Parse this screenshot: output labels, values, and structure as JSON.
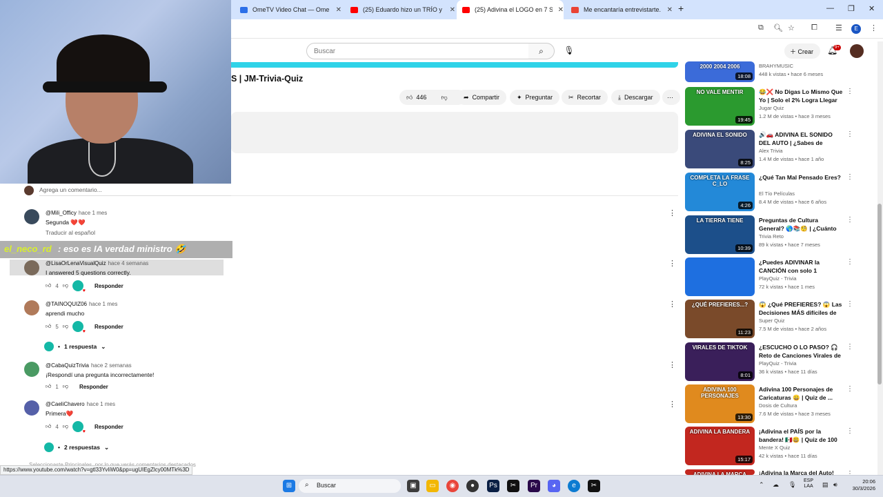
{
  "browser": {
    "tabs": [
      {
        "title": "OmeTV Video Chat — Ome",
        "fav": "#2c6fe8"
      },
      {
        "title": "(25) Eduardo hizo un TRÍO y nc",
        "fav": "#ff0000"
      },
      {
        "title": "(25) Adivina el LOGO en 7 SEG",
        "fav": "#ff0000",
        "active": true
      },
      {
        "title": "Me encantaría entrevistarte. -",
        "fav": "#ea4335"
      }
    ],
    "profile_initial": "E",
    "status_url": "https://www.youtube.com/watch?v=gtl33YvIiW0&pp=ugUIEgZlcy00MTk%3D"
  },
  "youtube": {
    "search_placeholder": "Buscar",
    "create_label": "Crear",
    "notif_count": "9+",
    "video_title": "S | JM-Trivia-Quiz",
    "actions": {
      "likes": "446",
      "share": "Compartir",
      "ask": "Preguntar",
      "clip": "Recortar",
      "download": "Descargar"
    },
    "add_comment": "Agrega un comentario...",
    "reply_label": "Responder",
    "translate_label": "Traducir al español",
    "sort_hint": "Seleccionaste Principales, por lo que verás comentarios destacados"
  },
  "chat_overlay": {
    "user": "el_neco_rd",
    "message": ": eso es IA verdad ministro 🤣"
  },
  "comments": [
    {
      "author": "@Mili_Officy",
      "time": "hace 1 mes",
      "text": "Segunda ❤️❤️",
      "likes": "",
      "translate": true,
      "avatar": "#394a5c"
    },
    {
      "author": "@LisaOrLenaVisualQuiz",
      "time": "hace 4 semanas",
      "text": "I answered 5 questions correctly.",
      "likes": "4",
      "avatar": "#7a6a5b"
    },
    {
      "author": "@TAINOQUIZ06",
      "time": "hace 1 mes",
      "text": "aprendi mucho",
      "likes": "5",
      "avatar": "#b07a5a"
    },
    {
      "author": "@CabaQuizTrivia",
      "time": "hace 2 semanas",
      "text": "¡Respondí una pregunta incorrectamente!",
      "likes": "1",
      "avatar": "#4a9a63"
    },
    {
      "author": "@CaeliChavero",
      "time": "hace 1 mes",
      "text": "Primera❤️",
      "likes": "4",
      "avatar": "#5560a8"
    }
  ],
  "replies": [
    "1 respuesta",
    "2 respuestas"
  ],
  "sidebar": [
    {
      "title": "",
      "channel": "BRAHYMUSIC",
      "meta": "448 k vistas • hace 6 meses",
      "duration": "18:08",
      "caption": "2000  2004  2006",
      "color": "#3b6bd9"
    },
    {
      "title": "😂❌ No Digas Lo Mismo Que Yo | Solo el 2% Logra Llegar",
      "channel": "Jugar Quiz",
      "meta": "1.2 M de vistas • hace 3 meses",
      "duration": "19:45",
      "caption": "NO VALE MENTIR",
      "color": "#2b9a2f"
    },
    {
      "title": "🔊🚗 ADIVINA EL SONIDO DEL AUTO | ¿Sabes de Autos? 🚗 ...",
      "channel": "Alex Trivia",
      "meta": "1.4 M de vistas • hace 1 año",
      "duration": "8:25",
      "caption": "ADIVINA EL SONIDO",
      "color": "#3a4a7a"
    },
    {
      "title": "¿Qué Tan Mal Pensado Eres?",
      "channel": "El Tío Películas",
      "meta": "8.4 M de vistas • hace 6 años",
      "duration": "4:26",
      "caption": "COMPLETA LA FRASE  C_LO",
      "color": "#2389d8"
    },
    {
      "title": "Preguntas de Cultura General? 🌎📚🧐 | ¿Cuánto Sabes? | ...",
      "channel": "Trivia Reto",
      "meta": "89 k vistas • hace 7 meses",
      "duration": "10:39",
      "caption": "LA TIERRA TIENE",
      "color": "#1c4f8a"
    },
    {
      "title": "¿Puedes ADIVINAR la CANCIÓN con solo 1 SEGUNDO de INTR...",
      "channel": "PlayQuiz - Trivia",
      "meta": "72 k vistas • hace 1 mes",
      "duration": "",
      "caption": "",
      "color": "#1e6fe0"
    },
    {
      "title": "😱 ¿Qué PREFIERES? 😱 Las Decisiones MÁS difíciles de T...",
      "channel": "Super Quiz",
      "meta": "7.5 M de vistas • hace 2 años",
      "duration": "11:23",
      "caption": "¿QUÉ PREFIERES...?",
      "color": "#7a4a2a"
    },
    {
      "title": "¿ESCUCHO O LO PASO? 🎧 Reto de Canciones Virales de ...",
      "channel": "PlayQuiz - Trivia",
      "meta": "36 k vistas • hace 11 días",
      "duration": "8:01",
      "caption": "VIRALES DE TIKTOK",
      "color": "#3a1f5a"
    },
    {
      "title": "Adivina 100 Personajes de Caricaturas 😀 | Quiz de ...",
      "channel": "Dosis de Cultura",
      "meta": "7.6 M de vistas • hace 3 meses",
      "duration": "13:30",
      "caption": "ADIVINA 100 PERSONAJES",
      "color": "#e08a1e"
    },
    {
      "title": "¡Adivina el PAÍS por la bandera! 🇲🇽😃 | Quiz de 100 banderas ...",
      "channel": "Mente X Quiz",
      "meta": "42 k vistas • hace 11 días",
      "duration": "15:17",
      "caption": "ADIVINA LA BANDERA",
      "color": "#c2271f"
    },
    {
      "title": "¡Adivina la Marca del Auto!",
      "channel": "",
      "meta": "",
      "duration": "",
      "caption": "ADIVINA LA MARCA",
      "color": "#c2271f"
    }
  ],
  "taskbar": {
    "search": "Buscar",
    "lang": "ESP\nLAA",
    "time": "20:06",
    "date": "30/3/2026"
  }
}
